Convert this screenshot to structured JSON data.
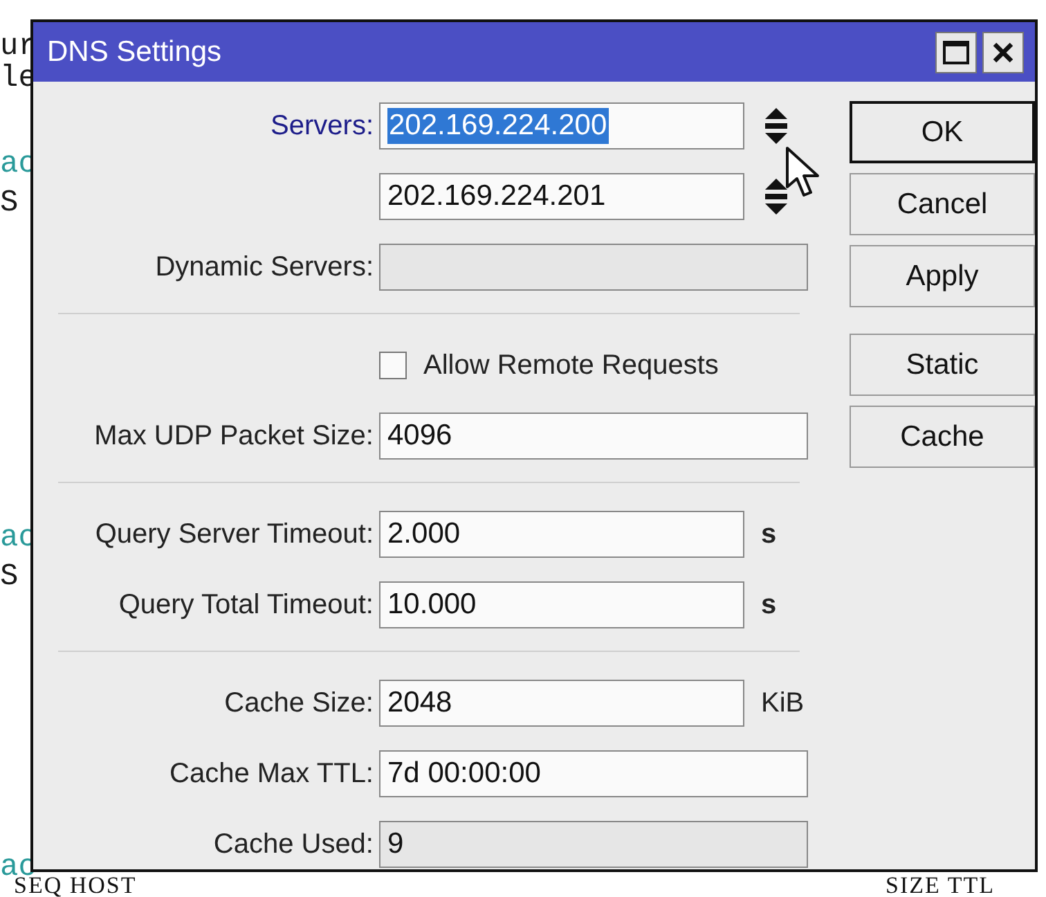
{
  "terminal": {
    "left_fragments": [
      {
        "text": "ur",
        "color": "#1a1a1a"
      },
      {
        "text": "le",
        "color": "#1a1a1a"
      },
      {
        "text": "ac",
        "color": "#2a9a9a"
      },
      {
        "text": "S",
        "color": "#1a1a1a"
      },
      {
        "text": "ac",
        "color": "#2a9a9a"
      },
      {
        "text": "S",
        "color": "#1a1a1a"
      },
      {
        "text": "ac",
        "color": "#2a9a9a"
      }
    ],
    "bottom": [
      "SEQ HOST",
      "SIZE TTL"
    ]
  },
  "window": {
    "title": "DNS Settings"
  },
  "rows": [
    {
      "kind": "server",
      "label": "Servers:",
      "value": "202.169.224.200",
      "selected": true
    },
    {
      "kind": "server",
      "value": "202.169.224.201",
      "selected": false
    },
    {
      "kind": "field",
      "label": "Dynamic Servers:",
      "disabled": true
    },
    {
      "kind": "separator"
    },
    {
      "kind": "checkbox",
      "label": "Allow Remote Requests",
      "checked": false
    },
    {
      "kind": "field",
      "label": "Max UDP Packet Size:",
      "value": "4096",
      "disabled": false
    },
    {
      "kind": "separator"
    },
    {
      "kind": "unit",
      "label": "Query Server Timeout:",
      "value": "2.000",
      "unit": "s"
    },
    {
      "kind": "unit",
      "label": "Query Total Timeout:",
      "value": "10.000",
      "unit": "s"
    },
    {
      "kind": "separator"
    },
    {
      "kind": "unit",
      "label": "Cache Size:",
      "value": "2048",
      "unit": "KiB"
    },
    {
      "kind": "field",
      "label": "Cache Max TTL:",
      "value": "7d 00:00:00",
      "disabled": false
    },
    {
      "kind": "field",
      "label": "Cache Used:",
      "value": "9",
      "disabled": true
    }
  ],
  "button_groups": [
    [
      {
        "label": "OK",
        "default": true
      },
      {
        "label": "Cancel",
        "default": false
      },
      {
        "label": "Apply",
        "default": false
      }
    ],
    [
      {
        "label": "Static",
        "default": false
      },
      {
        "label": "Cache",
        "default": false
      }
    ]
  ]
}
